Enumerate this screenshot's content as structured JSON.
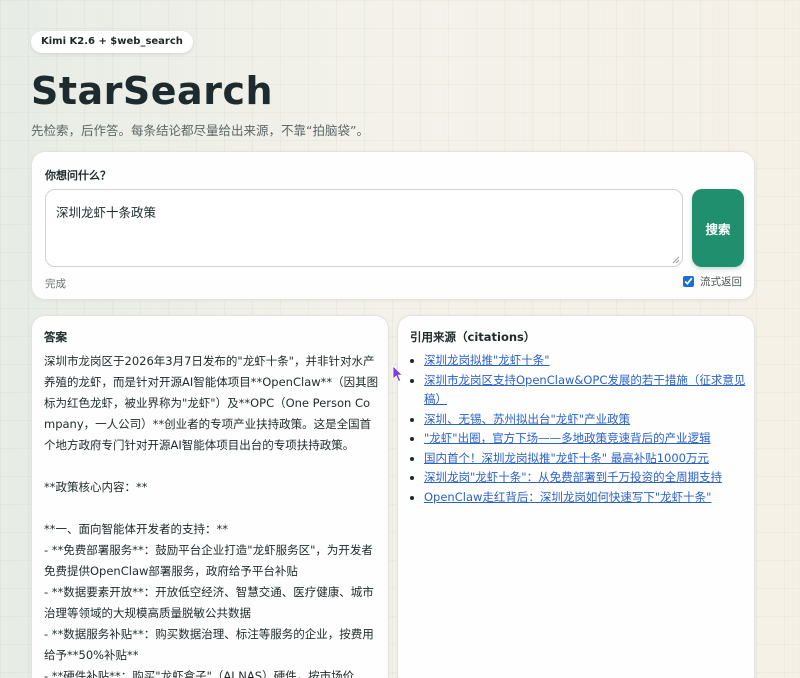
{
  "badge": "Kimi K2.6 + $web_search",
  "title": "StarSearch",
  "tagline": "先检索，后作答。每条结论都尽量给出来源，不靠“拍脑袋”。",
  "search": {
    "label": "你想问什么？",
    "query": "深圳龙虾十条政策",
    "button_label": "搜索",
    "status": "完成",
    "stream_label": "流式返回",
    "stream_checked": true
  },
  "answer": {
    "heading": "答案",
    "body": "深圳市龙岗区于2026年3月7日发布的\"龙虾十条\"，并非针对水产养殖的龙虾，而是针对开源AI智能体项目**OpenClaw**（因其图标为红色龙虾，被业界称为\"龙虾\"）及**OPC（One Person Company，一人公司）**创业者的专项产业扶持政策。这是全国首个地方政府专门针对开源AI智能体项目出台的专项扶持政策。\n\n**政策核心内容：**\n\n**一、面向智能体开发者的支持：**\n- **免费部署服务**：鼓励平台企业打造\"龙虾服务区\"，为开发者免费提供OpenClaw部署服务，政府给予平台补贴\n- **数据要素开放**：开放低空经济、智慧交通、医疗健康、城市治理等领域的大规模高质量脱敏公共数据\n- **数据服务补贴**：购买数据治理、标注等服务的企业，按费用给予**50%补贴**\n- **硬件补贴**：购买\"龙虾盒子\"（AI NAS）硬件，按市场价"
  },
  "citations": {
    "heading": "引用来源（citations）",
    "items": [
      "深圳龙岗拟推\"龙虾十条\"",
      "深圳市龙岗区支持OpenClaw&OPC发展的若干措施（征求意见稿）",
      "深圳、无锡、苏州拟出台\"龙虾\"产业政策",
      "\"龙虾\"出圈，官方下场——多地政策竞速背后的产业逻辑",
      "国内首个！深圳龙岗拟推\"龙虾十条\" 最高补贴1000万元",
      "深圳龙岗\"龙虾十条\"：从免费部署到千万投资的全周期支持",
      "OpenClaw走红背后：深圳龙岗如何快速写下\"龙虾十条\""
    ]
  },
  "colors": {
    "accent": "#1f8f6e",
    "link": "#2b62c7"
  }
}
